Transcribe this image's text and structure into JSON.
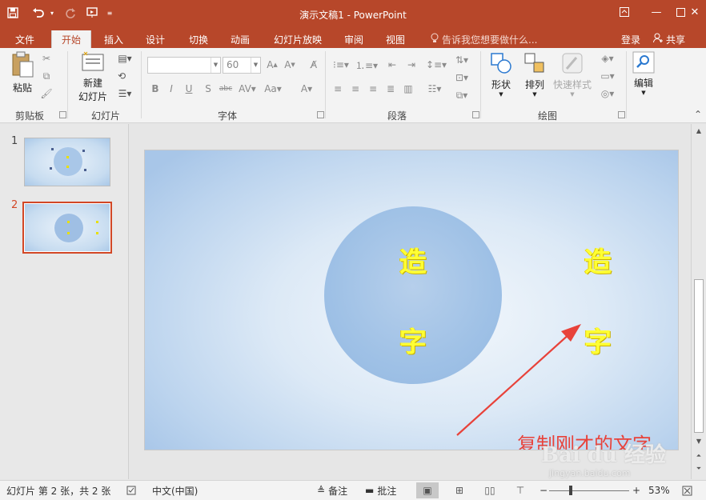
{
  "titlebar": {
    "title": "演示文稿1 - PowerPoint",
    "background_color": "#b7472a"
  },
  "tabs": [
    "文件",
    "开始",
    "插入",
    "设计",
    "切换",
    "动画",
    "幻灯片放映",
    "审阅",
    "视图"
  ],
  "active_tab": "开始",
  "tell_me_placeholder": "告诉我您想要做什么...",
  "account": {
    "login_label": "登录",
    "share_label": "共享"
  },
  "ribbon": {
    "clipboard": {
      "paste_label": "粘贴",
      "group_label": "剪贴板"
    },
    "slides": {
      "new_slide_label_line1": "新建",
      "new_slide_label_line2": "幻灯片",
      "group_label": "幻灯片"
    },
    "font": {
      "font_name_value": "",
      "font_size_value": "60",
      "group_label": "字体"
    },
    "paragraph": {
      "group_label": "段落"
    },
    "drawing": {
      "shapes_label": "形状",
      "arrange_label": "排列",
      "quick_styles_label": "快速样式",
      "group_label": "绘图"
    },
    "editing": {
      "edit_label": "编辑"
    }
  },
  "thumbnails": [
    {
      "number": "1",
      "selected": false
    },
    {
      "number": "2",
      "selected": true
    }
  ],
  "slide": {
    "circle_chars": [
      "造",
      "字"
    ],
    "side_chars": [
      "造",
      "字"
    ],
    "annotation_text": "复制刚才的文字",
    "annotation_color": "#e8423a",
    "char_color": "#ffff33"
  },
  "watermark": {
    "main": "Bai du 经验",
    "sub": "jingyan.baidu.com"
  },
  "statusbar": {
    "slide_info": "幻灯片 第 2 张，共 2 张",
    "language": "中文(中国)",
    "notes_label": "备注",
    "comments_label": "批注",
    "zoom_minus": "−",
    "zoom_plus": "+",
    "zoom_percent": "53%",
    "zoom_fraction": 0.53
  }
}
